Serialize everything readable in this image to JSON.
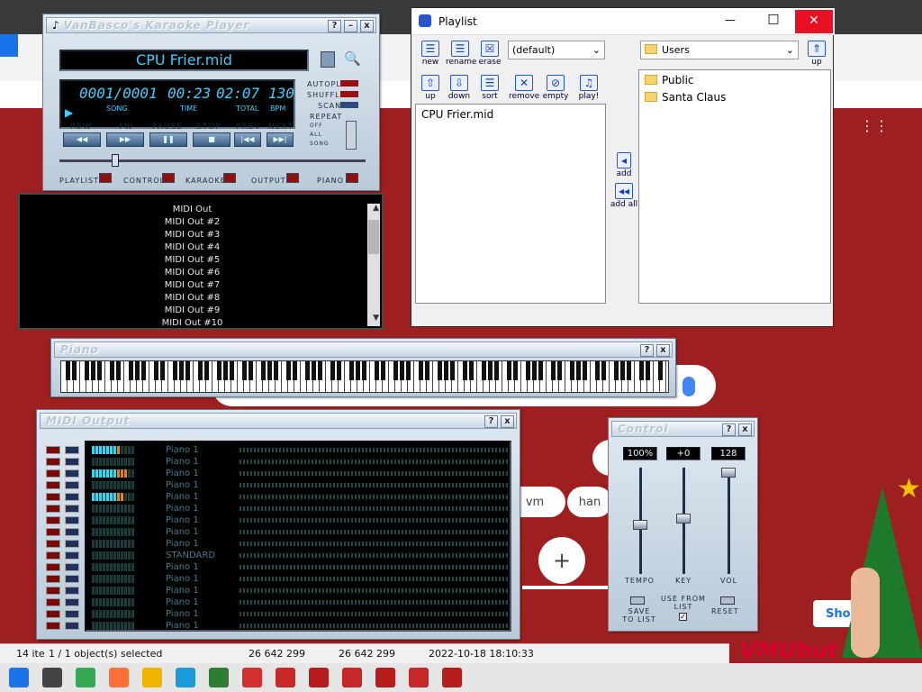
{
  "player": {
    "title": "VanBasco's Karaoke Player",
    "song": "CPU Frier.mid",
    "lcd": {
      "song_no": "0001/0001",
      "time": "00:23",
      "total": "02:07",
      "bpm": "130",
      "song_lbl": "SONG",
      "time_lbl": "TIME",
      "total_lbl": "TOTAL",
      "bpm_lbl": "BPM"
    },
    "modes": {
      "autoplay": "Autoplay",
      "shuffle": "Shuffle",
      "scan": "Scan",
      "repeat": "Repeat",
      "off": "Off",
      "all": "All",
      "song": "Song"
    },
    "transport": [
      "Rew",
      "Fw",
      "Pause",
      "Stop",
      "Prev",
      "Next"
    ],
    "toggles": [
      "Playlist",
      "Control",
      "Karaoke",
      "Output",
      "Piano"
    ],
    "help": "?",
    "minimize": "–",
    "close": "x"
  },
  "midi_out_list": {
    "items": [
      "MIDI Out",
      "MIDI Out #2",
      "MIDI Out #3",
      "MIDI Out #4",
      "MIDI Out #5",
      "MIDI Out #6",
      "MIDI Out #7",
      "MIDI Out #8",
      "MIDI Out #9",
      "MIDI Out #10"
    ],
    "selected": "MIDI Out"
  },
  "playlist": {
    "title": "Playlist",
    "list_combo": "(default)",
    "folder_combo": "Users",
    "top_buttons": [
      "new",
      "rename",
      "erase"
    ],
    "bottom_buttons": [
      "up",
      "down",
      "sort",
      "remove",
      "empty",
      "play!"
    ],
    "folder_up": "up",
    "add": "add",
    "add_all": "add all",
    "files": [
      "CPU Frier.mid"
    ],
    "folders": [
      "Public",
      "Santa Claus"
    ],
    "win_close": "✕",
    "win_max": "□",
    "win_min": "—"
  },
  "piano": {
    "title": "Piano",
    "help": "?",
    "close": "x"
  },
  "midi_output": {
    "title": "MIDI Output",
    "help": "?",
    "close": "x",
    "channels": [
      "Piano 1",
      "Piano 1",
      "Piano 1",
      "Piano 1",
      "Piano 1",
      "Piano 1",
      "Piano 1",
      "Piano 1",
      "Piano 1",
      "STANDARD",
      "Piano 1",
      "Piano 1",
      "Piano 1",
      "Piano 1",
      "Piano 1",
      "Piano 1"
    ],
    "levels": [
      8,
      0,
      10,
      0,
      9,
      0,
      0,
      0,
      0,
      0,
      0,
      0,
      0,
      0,
      0,
      0
    ]
  },
  "control": {
    "title": "Control",
    "help": "?",
    "close": "x",
    "tempo": "100%",
    "key": "+0",
    "vol": "128",
    "tempo_lbl": "Tempo",
    "key_lbl": "Key",
    "vol_lbl": "Vol",
    "save": "Save to List",
    "use": "Use from List",
    "reset": "Reset",
    "use_checked": true
  },
  "statusbar": {
    "left": "14 ite",
    "selected": "1 / 1 object(s) selected",
    "size1": "26 642 299",
    "size2": "26 642 299",
    "date": "2022-10-18 18:10:33"
  },
  "background": {
    "btn1": "vm",
    "btn2": "han",
    "plus": "+",
    "show": "Show",
    "brand": "VMUbut"
  },
  "taskbar": {
    "icons": [
      "start-icon",
      "task-view-icon",
      "chrome-icon",
      "firefox-icon",
      "explorer-icon",
      "maps-icon",
      "game-icon",
      "media-icon",
      "tool-icon",
      "calculator-icon",
      "zip-icon",
      "karaoke-icon",
      "om-icon",
      "box-icon"
    ]
  }
}
